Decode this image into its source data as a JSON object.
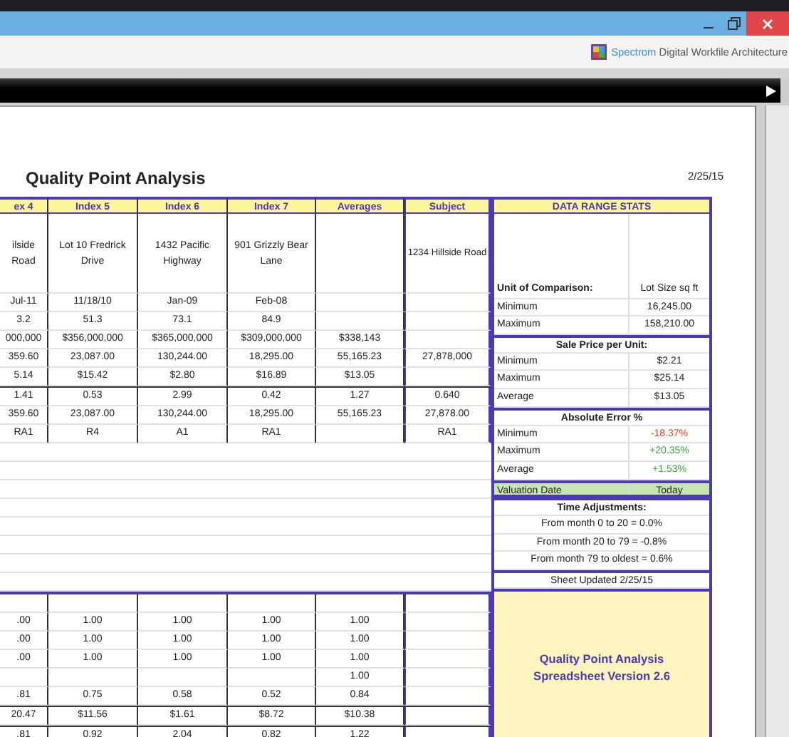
{
  "toolbar": {
    "brand": "Spectrom",
    "product": "Digital Workfile Architecture"
  },
  "sheet": {
    "title": "Quality Point Analysis",
    "date": "2/25/15",
    "columns": [
      "ex 4",
      "Index 5",
      "Index 6",
      "Index 7",
      "Averages",
      "Subject"
    ],
    "sections": [
      {
        "blocks": [
          {
            "rows": [
              {
                "kind": "address",
                "cells": [
                  "ilside Road",
                  "Lot 10 Fredrick Drive",
                  "1432 Pacific Highway",
                  "901 Grizzly Bear Lane",
                  null,
                  "1234 Hillside Road"
                ]
              },
              {
                "kind": "data",
                "cells": [
                  "Jul-11",
                  "11/18/10",
                  "Jan-09",
                  "Feb-08",
                  null,
                  null
                ]
              },
              {
                "kind": "data",
                "cells": [
                  "3.2",
                  "51.3",
                  "73.1",
                  "84.9",
                  null,
                  null
                ]
              },
              {
                "kind": "data",
                "cells": [
                  "000,000",
                  "$356,000,000",
                  "$365,000,000",
                  "$309,000,000",
                  "$338,143",
                  null
                ]
              },
              {
                "kind": "data",
                "cells": [
                  "359.60",
                  "23,087.00",
                  "130,244.00",
                  "18,295.00",
                  "55,165.23",
                  "27,878,000"
                ]
              },
              {
                "kind": "data",
                "cells": [
                  "5.14",
                  "$15.42",
                  "$2.80",
                  "$16.89",
                  "$13.05",
                  null
                ]
              }
            ]
          },
          {
            "rows": [
              {
                "kind": "data",
                "cells": [
                  "1.41",
                  "0.53",
                  "2.99",
                  "0.42",
                  "1.27",
                  "0.640"
                ]
              },
              {
                "kind": "data",
                "cells": [
                  "359.60",
                  "23,087.00",
                  "130,244.00",
                  "18,295.00",
                  "55,165.23",
                  "27,878.00"
                ]
              },
              {
                "kind": "data",
                "cells": [
                  "RA1",
                  "R4",
                  "A1",
                  "RA1",
                  null,
                  "RA1"
                ]
              }
            ]
          }
        ]
      },
      {
        "blocks": [
          {
            "rows": [
              {
                "kind": "data",
                "cells": [
                  ".00",
                  "1.00",
                  "1.00",
                  "1.00",
                  "1.00",
                  null
                ]
              },
              {
                "kind": "data",
                "cells": [
                  ".00",
                  "1.00",
                  "1.00",
                  "1.00",
                  "1.00",
                  null
                ]
              },
              {
                "kind": "data",
                "cells": [
                  ".00",
                  "1.00",
                  "1.00",
                  "1.00",
                  "1.00",
                  null
                ]
              },
              {
                "kind": "data",
                "cells": [
                  null,
                  null,
                  null,
                  null,
                  "1.00",
                  null
                ]
              },
              {
                "kind": "data",
                "cells": [
                  ".81",
                  "0.75",
                  "0.58",
                  "0.52",
                  "0.84",
                  null
                ]
              }
            ]
          },
          {
            "rows": [
              {
                "kind": "data",
                "cells": [
                  "20.47",
                  "$11.56",
                  "$1.61",
                  "$8.72",
                  "$10.38",
                  null
                ]
              }
            ]
          },
          {
            "rows": [
              {
                "kind": "data",
                "cells": [
                  ".81",
                  "0.92",
                  "2.04",
                  "0.82",
                  "1.22",
                  null
                ]
              }
            ]
          }
        ]
      }
    ]
  },
  "stats": {
    "title": "DATA RANGE STATS",
    "rows": [
      {
        "kind": "caption",
        "label": "Unit of Comparison:",
        "value": "Lot Size sq ft"
      },
      {
        "kind": "pair",
        "label": "Minimum",
        "value": "16,245.00"
      },
      {
        "kind": "pair",
        "label": "Maximum",
        "value": "158,210.00"
      },
      {
        "kind": "heading",
        "text": "Sale Price per Unit:"
      },
      {
        "kind": "pair",
        "label": "Minimum",
        "value": "$2.21"
      },
      {
        "kind": "pair",
        "label": "Maximum",
        "value": "$25.14"
      },
      {
        "kind": "pair",
        "label": "Average",
        "value": "$13.05"
      },
      {
        "kind": "heading",
        "text": "Absolute Error %"
      },
      {
        "kind": "pair",
        "label": "Minimum",
        "value": "-18.37%",
        "color": "#e0452a"
      },
      {
        "kind": "pair",
        "label": "Maximum",
        "value": "+20.35%",
        "color": "#3aa844"
      },
      {
        "kind": "pair",
        "label": "Average",
        "value": "+1.53%",
        "color": "#3aa844"
      },
      {
        "kind": "highlight",
        "label": "Valuation Date",
        "value": "Today"
      },
      {
        "kind": "heading",
        "text": "Time Adjustments:"
      },
      {
        "kind": "note",
        "text": "From month 0 to 20 = 0.0%"
      },
      {
        "kind": "note",
        "text": "From month 20 to 79 = -0.8%"
      },
      {
        "kind": "note",
        "text": "From month 79 to oldest = 0.6%"
      },
      {
        "kind": "footer",
        "text": "Sheet Updated 2/25/15"
      }
    ]
  },
  "version_box": {
    "lines": [
      "Quality Point Analysis",
      "Spreadsheet Version 2.6"
    ]
  }
}
